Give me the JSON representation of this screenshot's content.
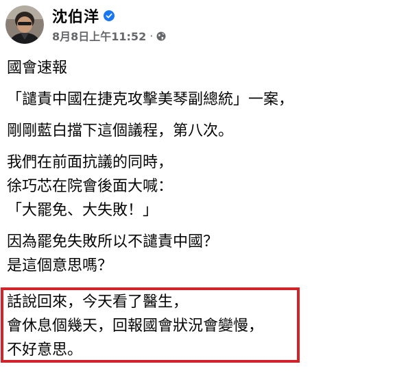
{
  "author": {
    "name": "沈伯洋",
    "verified": true,
    "verified_color": "#1877f2"
  },
  "post": {
    "timestamp": "8月8日上午11:52",
    "separator": "·",
    "audience_icon": "globe-icon",
    "paragraphs": [
      {
        "lines": [
          "國會速報"
        ]
      },
      {
        "lines": [
          "「譴責中國在捷克攻擊美琴副總統」一案，"
        ]
      },
      {
        "lines": [
          "剛剛藍白擋下這個議程，第八次。"
        ]
      },
      {
        "lines": [
          "我們在前面抗議的同時，",
          "徐巧芯在院會後面大喊：",
          "「大罷免、大失敗！」"
        ]
      },
      {
        "lines": [
          "因為罷免失敗所以不譴責中國？",
          "是這個意思嗎？"
        ]
      }
    ],
    "highlighted_paragraph": {
      "lines": [
        "話說回來，今天看了醫生，",
        "會休息個幾天，回報國會狀況會變慢，",
        "不好意思。"
      ],
      "border_color": "#d1232a"
    }
  }
}
